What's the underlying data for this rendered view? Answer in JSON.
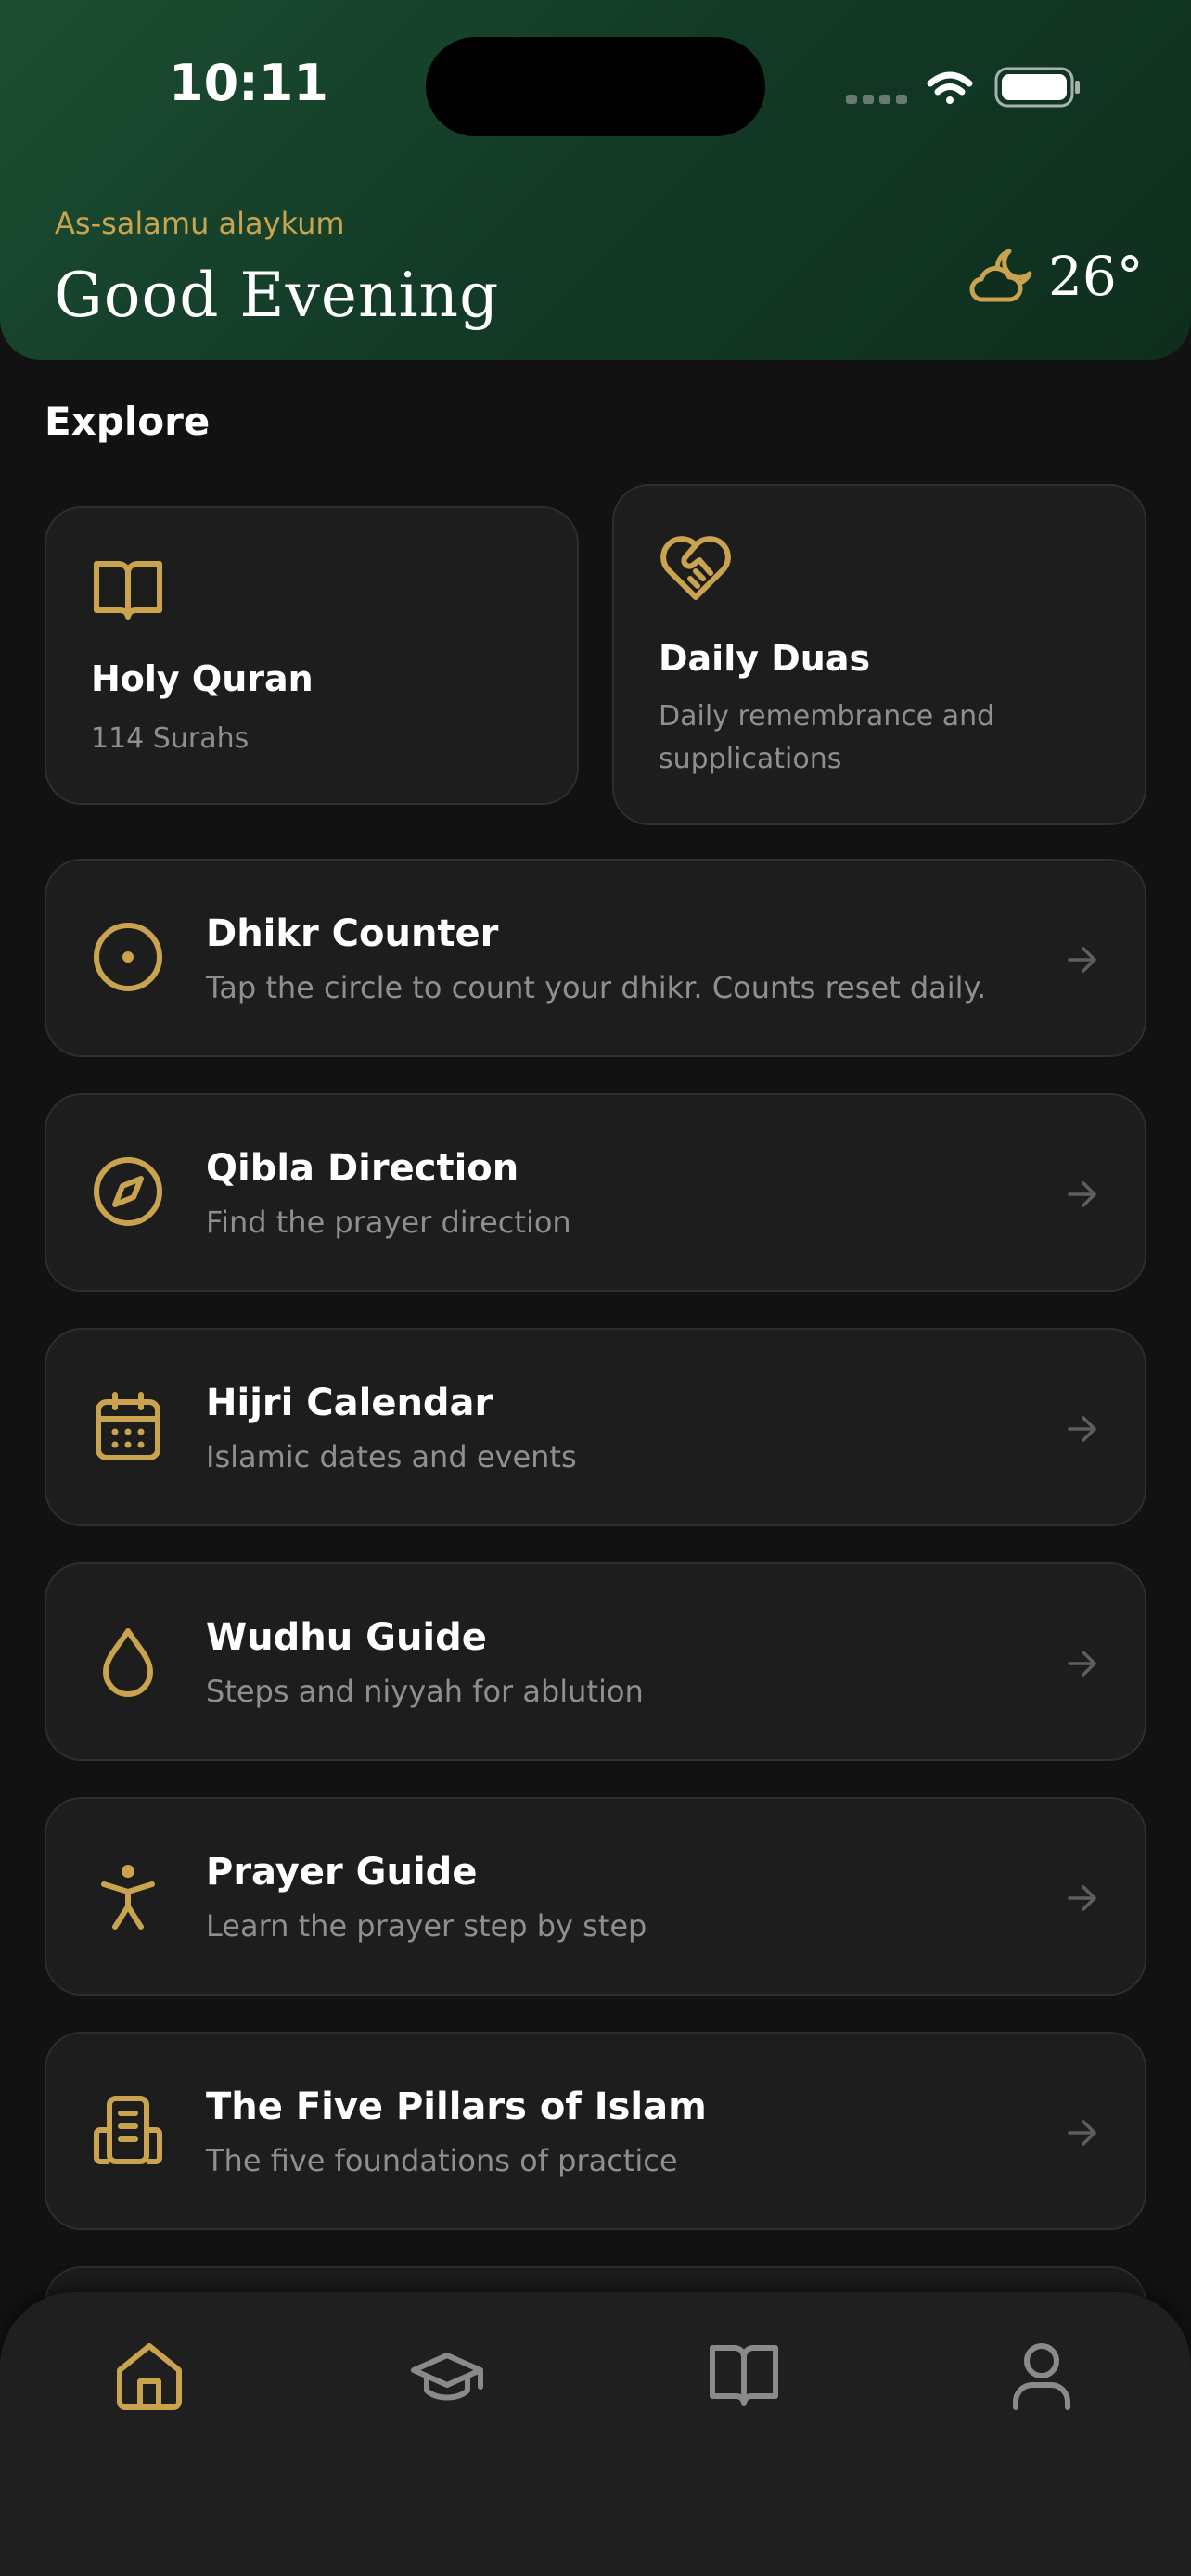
{
  "status_bar": {
    "time": "10:11"
  },
  "header": {
    "greeting_small": "As-salamu alaykum",
    "greeting_big": "Good Evening",
    "weather": {
      "icon": "moon-cloud-icon",
      "temperature": "26°"
    }
  },
  "explore": {
    "title": "Explore",
    "cards": [
      {
        "icon": "book-open-icon",
        "title": "Holy Quran",
        "subtitle": "114 Surahs"
      },
      {
        "icon": "heart-handshake-icon",
        "title": "Daily Duas",
        "subtitle": "Daily remembrance and supplications"
      }
    ],
    "list": [
      {
        "icon": "circle-dot-icon",
        "title": "Dhikr Counter",
        "subtitle": "Tap the circle to count your dhikr. Counts reset daily."
      },
      {
        "icon": "compass-icon",
        "title": "Qibla Direction",
        "subtitle": "Find the prayer direction"
      },
      {
        "icon": "calendar-icon",
        "title": "Hijri Calendar",
        "subtitle": "Islamic dates and events"
      },
      {
        "icon": "droplet-icon",
        "title": "Wudhu Guide",
        "subtitle": "Steps and niyyah for ablution"
      },
      {
        "icon": "person-icon",
        "title": "Prayer Guide",
        "subtitle": "Learn the prayer step by step"
      },
      {
        "icon": "building-icon",
        "title": "The Five Pillars of Islam",
        "subtitle": "The five foundations of practice"
      }
    ]
  },
  "bottom_nav": [
    {
      "icon": "home-icon",
      "active": true
    },
    {
      "icon": "graduation-cap-icon",
      "active": false
    },
    {
      "icon": "book-open-icon",
      "active": false
    },
    {
      "icon": "user-icon",
      "active": false
    }
  ],
  "colors": {
    "accent": "#c9a34e",
    "header_green": "#1c4d32",
    "background": "#121212",
    "card": "#1d1d1d"
  }
}
